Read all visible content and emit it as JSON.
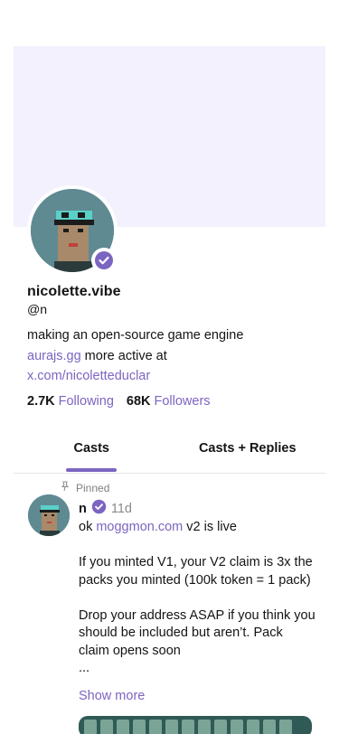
{
  "profile": {
    "display_name": "nicolette.vibe",
    "username": "@n",
    "bio_line1": "making an open-source game engine",
    "bio_link1": "aurajs.gg",
    "bio_line2_rest": " more active at",
    "bio_link2": "x.com/nicoletteduclar",
    "following_count": "2.7K",
    "following_label": "Following",
    "followers_count": "68K",
    "followers_label": "Followers"
  },
  "tabs": [
    {
      "label": "Casts",
      "active": true
    },
    {
      "label": "Casts + Replies",
      "active": false
    }
  ],
  "post": {
    "pinned_label": "Pinned",
    "author": "n",
    "time": "11d",
    "line1_prefix": "ok ",
    "line1_link": "moggmon.com",
    "line1_suffix": " v2 is live",
    "para2": "If you minted V1, your V2 claim is 3x the packs you minted (100k token  = 1 pack)",
    "para3": "Drop your address ASAP if you think you should be included but aren’t. Pack claim opens soon",
    "ellipsis": "...",
    "show_more": "Show more"
  },
  "colors": {
    "accent": "#7c65c1",
    "banner": "#f3f1fd",
    "verified": "#7c65c1"
  },
  "icons": {
    "verified": "verified-badge-icon",
    "pin": "pin-icon"
  }
}
